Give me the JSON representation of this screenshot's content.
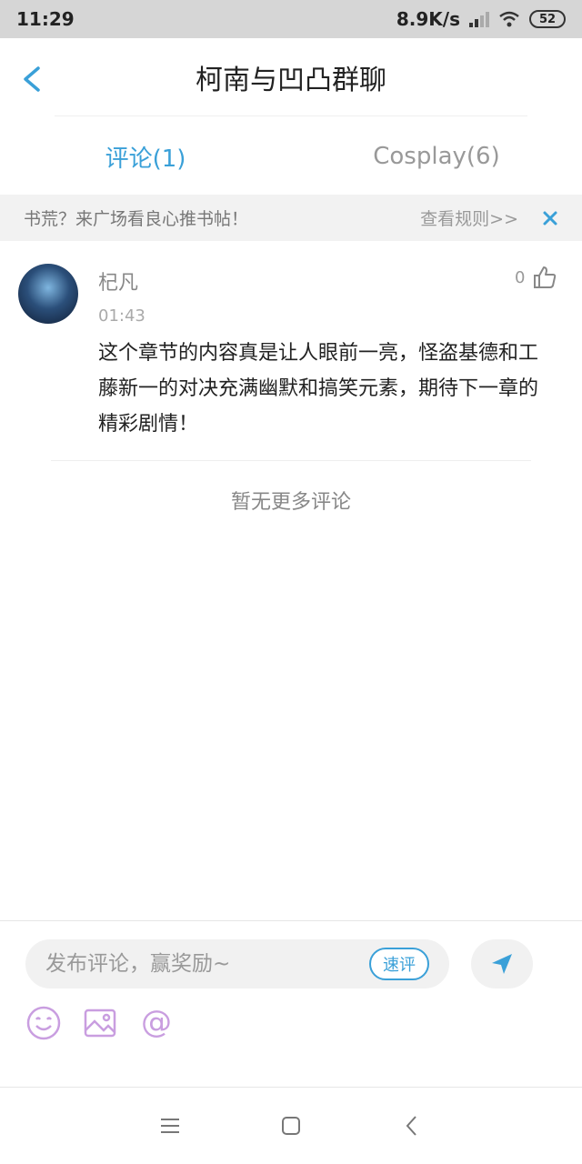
{
  "status": {
    "time": "11:29",
    "speed": "8.9K/s",
    "battery": "52"
  },
  "header": {
    "title": "柯南与凹凸群聊"
  },
  "tabs": [
    {
      "label": "评论(1)",
      "active": true
    },
    {
      "label": "Cosplay(6)",
      "active": false
    }
  ],
  "notice": {
    "text": "书荒？来广场看良心推书帖！",
    "link": "查看规则>>"
  },
  "comments": [
    {
      "username": "杞凡",
      "time": "01:43",
      "likes": "0",
      "body": "这个章节的内容真是让人眼前一亮，怪盗基德和工藤新一的对决充满幽默和搞笑元素，期待下一章的精彩剧情！"
    }
  ],
  "no_more": "暂无更多评论",
  "composer": {
    "placeholder": "发布评论，赢奖励~",
    "quick_label": "速评"
  },
  "colors": {
    "accent": "#3aa0d8",
    "tool_icon": "#c99ee0"
  }
}
